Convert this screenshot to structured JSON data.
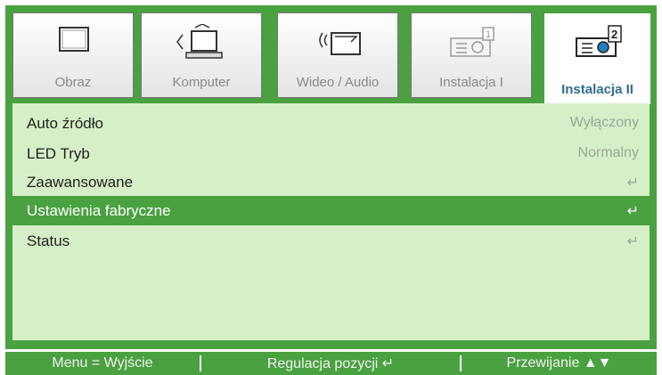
{
  "tabs": [
    {
      "label": "Obraz",
      "icon": "display-icon"
    },
    {
      "label": "Komputer",
      "icon": "computer-icon"
    },
    {
      "label": "Wideo / Audio",
      "icon": "video-audio-icon"
    },
    {
      "label": "Instalacja I",
      "icon": "projector-settings-icon"
    },
    {
      "label": "Instalacja II",
      "icon": "projector-help-icon"
    }
  ],
  "active_tab": "Instalacja II",
  "menu": [
    {
      "label": "Auto źródło",
      "value": "Wyłączony"
    },
    {
      "label": "LED Tryb",
      "value": "Normalny"
    },
    {
      "label": "Zaawansowane",
      "value": "↵"
    },
    {
      "label": "Ustawienia fabryczne",
      "value": "↵"
    },
    {
      "label": "Status",
      "value": "↵"
    }
  ],
  "selected_item": "Ustawienia fabryczne",
  "footer": {
    "menu_exit": "Menu = Wyjście",
    "adjust": "Regulacja pozycji ↵",
    "scroll": "Przewijanie ▲▼"
  },
  "colors": {
    "accent": "#4aa140",
    "panel": "#d6efc7",
    "active_tab_text": "#2f6f8f"
  }
}
